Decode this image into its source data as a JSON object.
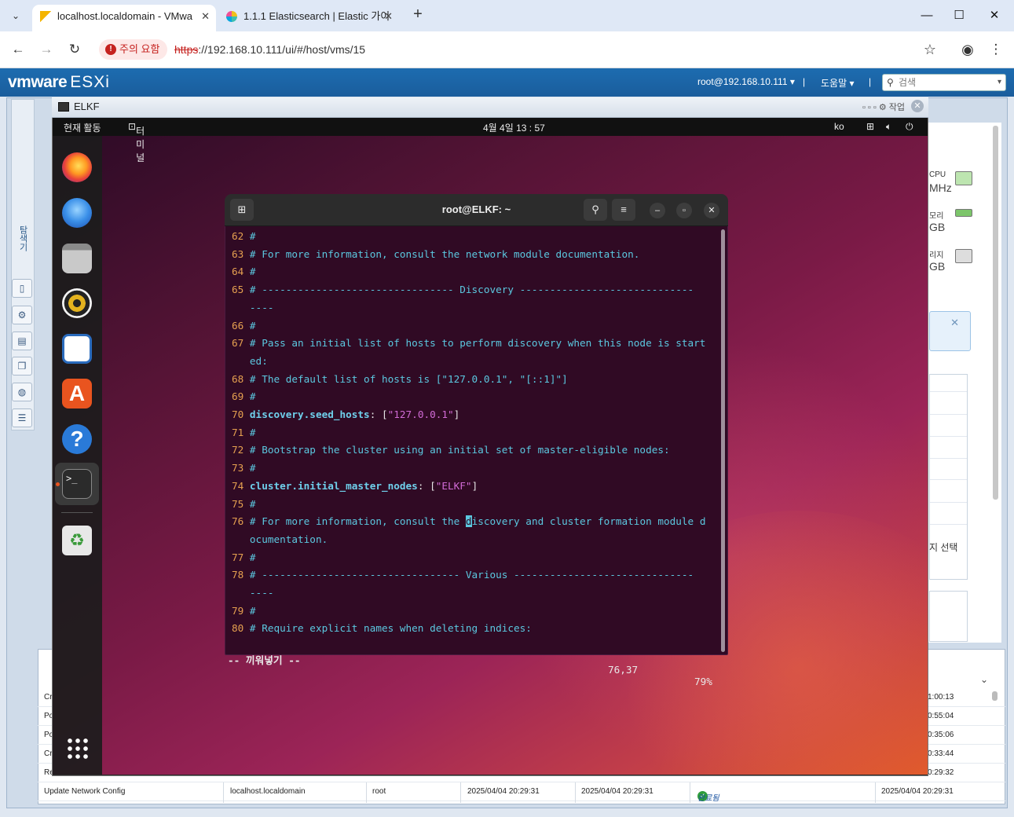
{
  "browser": {
    "tabs": [
      {
        "title": "localhost.localdomain - VMwa",
        "active": true
      },
      {
        "title": "1.1.1 Elasticsearch | Elastic 가이",
        "active": false
      }
    ],
    "security_label": "주의 요함",
    "url_scheme": "https",
    "url_rest": "://192.168.10.111/ui/#/host/vms/15"
  },
  "esxi": {
    "brand": "vmware",
    "product": "ESXi",
    "user_menu": "root@192.168.10.111",
    "help_menu": "도움말",
    "search_placeholder": "검색",
    "side_label": "탐색기",
    "right_labels": {
      "cpu": "CPU",
      "cpu_unit": "MHz",
      "mem": "모리",
      "mem_unit": "GB",
      "storage": "리지",
      "storage_unit": "GB",
      "select": "지 선택"
    }
  },
  "console": {
    "vm_name": "ELKF",
    "actions_label": "작업",
    "gnome": {
      "activities": "현재 활동",
      "app": "터미널",
      "clock": "4월 4일  13 : 57",
      "lang": "ko"
    },
    "terminal_title": "root@ELKF: ~",
    "lines": [
      {
        "n": "62",
        "segs": [
          {
            "t": "#",
            "c": "comment"
          }
        ]
      },
      {
        "n": "63",
        "segs": [
          {
            "t": "# For more information, consult the network module documentation.",
            "c": "comment"
          }
        ]
      },
      {
        "n": "64",
        "segs": [
          {
            "t": "#",
            "c": "comment"
          }
        ]
      },
      {
        "n": "65",
        "segs": [
          {
            "t": "# -------------------------------- Discovery -----------------------------",
            "c": "comment"
          }
        ]
      },
      {
        "n": "",
        "segs": [
          {
            "t": "----",
            "c": "comment"
          }
        ]
      },
      {
        "n": "66",
        "segs": [
          {
            "t": "#",
            "c": "comment"
          }
        ]
      },
      {
        "n": "67",
        "segs": [
          {
            "t": "# Pass an initial list of hosts to perform discovery when this node is start",
            "c": "comment"
          }
        ]
      },
      {
        "n": "",
        "segs": [
          {
            "t": "ed:",
            "c": "comment"
          }
        ]
      },
      {
        "n": "68",
        "segs": [
          {
            "t": "# The default list of hosts is [\"127.0.0.1\", \"[::1]\"]",
            "c": "comment"
          }
        ]
      },
      {
        "n": "69",
        "segs": [
          {
            "t": "#",
            "c": "comment"
          }
        ]
      },
      {
        "n": "70",
        "segs": [
          {
            "t": "discovery.seed_hosts",
            "c": "key"
          },
          {
            "t": ": [",
            "c": "plain"
          },
          {
            "t": "\"127.0.0.1\"",
            "c": "str"
          },
          {
            "t": "]",
            "c": "plain"
          }
        ]
      },
      {
        "n": "71",
        "segs": [
          {
            "t": "#",
            "c": "comment"
          }
        ]
      },
      {
        "n": "72",
        "segs": [
          {
            "t": "# Bootstrap the cluster using an initial set of master-eligible nodes:",
            "c": "comment"
          }
        ]
      },
      {
        "n": "73",
        "segs": [
          {
            "t": "#",
            "c": "comment"
          }
        ]
      },
      {
        "n": "74",
        "segs": [
          {
            "t": "cluster.initial_master_nodes",
            "c": "key"
          },
          {
            "t": ": [",
            "c": "plain"
          },
          {
            "t": "\"ELKF\"",
            "c": "str"
          },
          {
            "t": "]",
            "c": "plain"
          }
        ]
      },
      {
        "n": "75",
        "segs": [
          {
            "t": "#",
            "c": "comment"
          }
        ]
      },
      {
        "n": "76",
        "segs": [
          {
            "t": "# For more information, consult the ",
            "c": "comment"
          },
          {
            "t": "d",
            "c": "cursor"
          },
          {
            "t": "iscovery and cluster formation module d",
            "c": "comment"
          }
        ]
      },
      {
        "n": "",
        "segs": [
          {
            "t": "ocumentation.",
            "c": "comment"
          }
        ]
      },
      {
        "n": "77",
        "segs": [
          {
            "t": "#",
            "c": "comment"
          }
        ]
      },
      {
        "n": "78",
        "segs": [
          {
            "t": "# --------------------------------- Various ------------------------------",
            "c": "comment"
          }
        ]
      },
      {
        "n": "",
        "segs": [
          {
            "t": "----",
            "c": "comment"
          }
        ]
      },
      {
        "n": "79",
        "segs": [
          {
            "t": "#",
            "c": "comment"
          }
        ]
      },
      {
        "n": "80",
        "segs": [
          {
            "t": "# Require explicit names when deleting indices:",
            "c": "comment"
          }
        ]
      }
    ],
    "status_mode": "-- 끼워넣기 --",
    "status_pos": "76,37",
    "status_pct": "79%"
  },
  "tasks": {
    "partial_left": [
      "Cr",
      "Po",
      "Po",
      "Cr",
      "Re"
    ],
    "partial_right": [
      "1:00:13",
      "0:55:04",
      "0:35:06",
      "0:33:44",
      "0:29:32"
    ],
    "last_row": {
      "task": "Update Network Config",
      "target": "localhost.localdomain",
      "initiator": "root",
      "queued": "2025/04/04 20:29:31",
      "started": "2025/04/04 20:29:31",
      "result": "완료됨",
      "completed": "2025/04/04 20:29:31"
    }
  }
}
